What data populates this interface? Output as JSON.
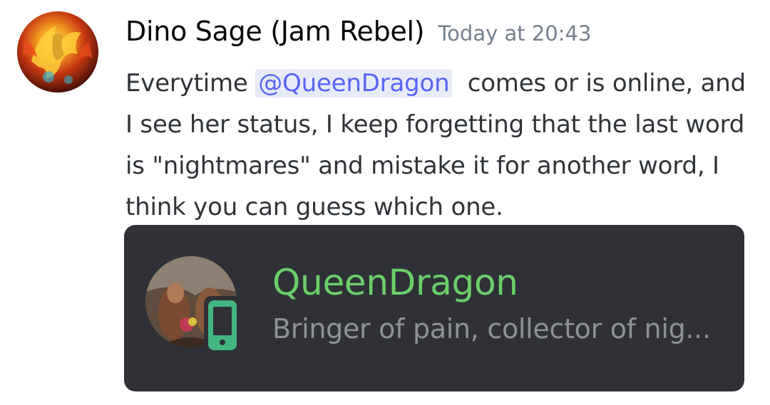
{
  "message": {
    "author": "Dino Sage (Jam Rebel)",
    "timestamp": "Today at 20:43",
    "avatar_icon": "dragon-avatar-icon",
    "text_before_mention": "Everytime ",
    "mention": "@QueenDragon",
    "text_after_mention": "  comes or is online, and I see her status, I keep forgetting that the last word is \"nightmares\" and mistake it for another word, I think you can guess which one."
  },
  "embed": {
    "username": "QueenDragon",
    "status": "Bringer of pain, collector of nig...",
    "status_icon": "mobile-phone-icon",
    "colors": {
      "background": "#2f3136",
      "username": "#6ccf6a",
      "status_text": "#8e9297",
      "mobile_indicator": "#43b581"
    }
  },
  "colors": {
    "mention_bg": "#e7ebf8",
    "mention_text": "#5865f2",
    "timestamp": "#747f8d"
  }
}
